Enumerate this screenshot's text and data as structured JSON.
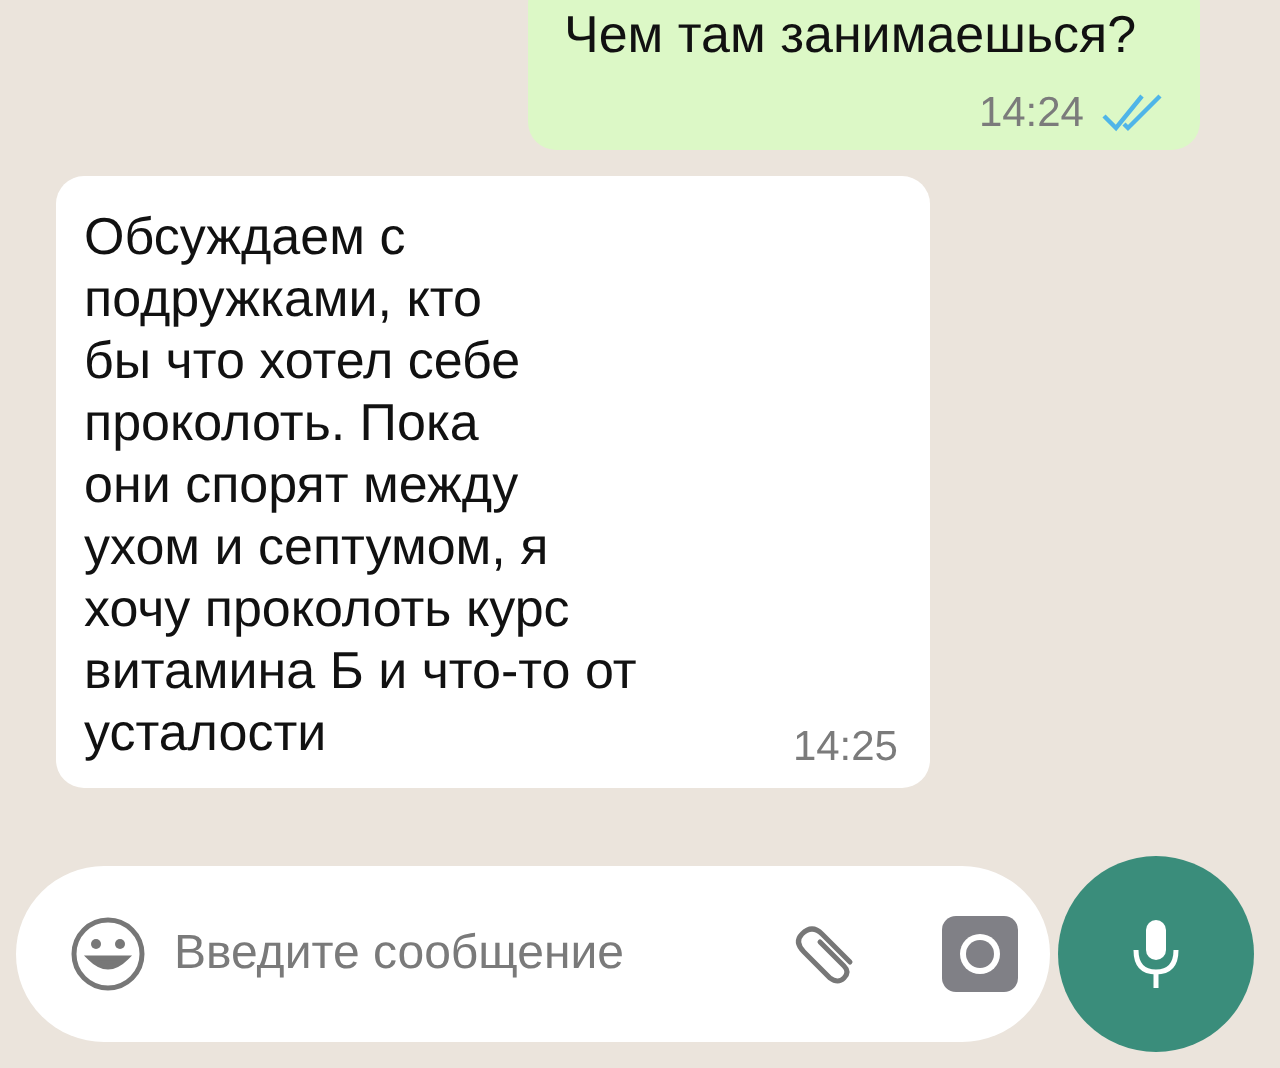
{
  "messages": [
    {
      "kind": "outgoing",
      "lines": [
        "Чем там занимаешься?"
      ],
      "time": "14:24",
      "read": true
    },
    {
      "kind": "incoming",
      "lines": [
        "Обсуждаем с",
        "подружками, кто",
        "бы что хотел себе",
        "проколоть. Пока",
        "они спорят между",
        "ухом и септумом, я",
        "хочу проколоть курс",
        "витамина Б и что-то от",
        "усталости"
      ],
      "time": "14:25"
    }
  ],
  "composer": {
    "placeholder": "Введите сообщение"
  }
}
